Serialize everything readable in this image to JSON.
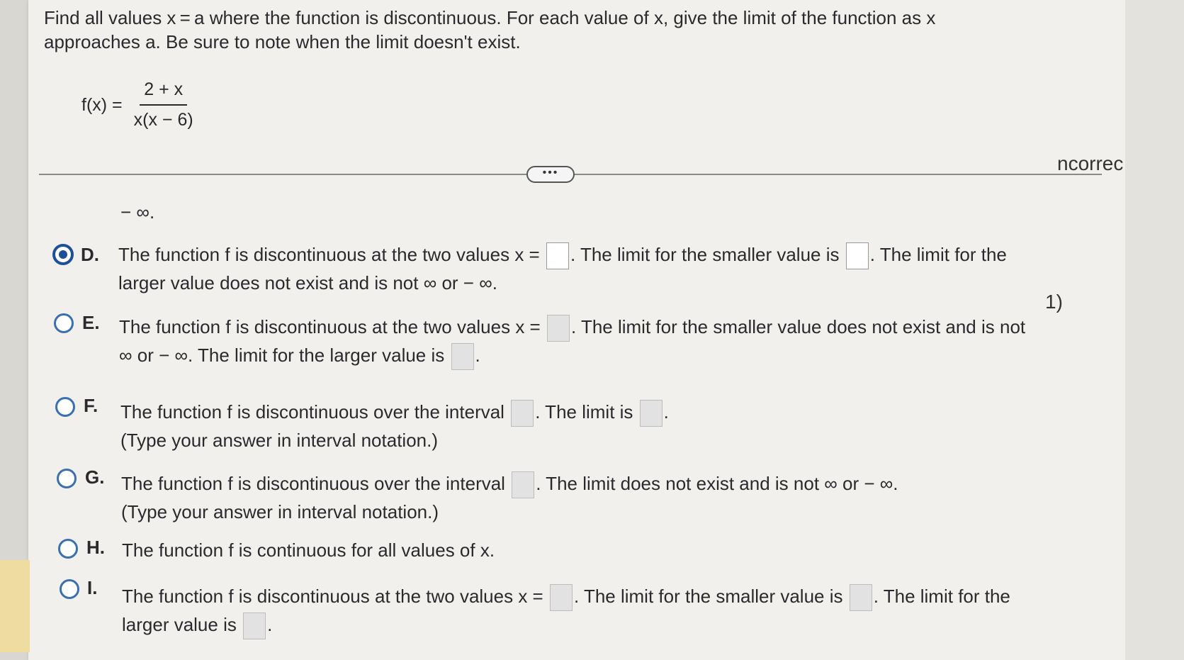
{
  "question": "Find all values x = a where the function is discontinuous. For each value of x, give the limit of the function as x approaches a. Be sure to note when the limit doesn't exist.",
  "function_label": "f(x) =",
  "numerator": "2 + x",
  "denominator": "x(x − 6)",
  "more_button": "•••",
  "fragment": "− ∞.",
  "side_panel": {
    "label": "ncorrec",
    "number": "1)"
  },
  "options": {
    "D": {
      "letter": "D.",
      "selected": true,
      "p1": "The function f is discontinuous at the two values x =",
      "p2": ". The limit for the smaller value is",
      "p3": ". The limit for the",
      "p4": "larger value does not exist and is not ∞ or − ∞."
    },
    "E": {
      "letter": "E.",
      "selected": false,
      "p1": "The function f is discontinuous at the two values x =",
      "p2": ". The limit for the smaller value does not exist and is not",
      "p3": "∞ or − ∞. The limit for the larger value is",
      "p4": "."
    },
    "F": {
      "letter": "F.",
      "selected": false,
      "p1": "The function f is discontinuous over the interval",
      "p2": ". The limit is",
      "p3": ".",
      "p4": "(Type your answer in interval notation.)"
    },
    "G": {
      "letter": "G.",
      "selected": false,
      "p1": "The function f is discontinuous over the interval",
      "p2": ". The limit does not exist and is not ∞ or − ∞.",
      "p3": "(Type your answer in interval notation.)"
    },
    "H": {
      "letter": "H.",
      "selected": false,
      "p1": "The function f is continuous for all values of x."
    },
    "I": {
      "letter": "I.",
      "selected": false,
      "p1": "The function f is discontinuous at the two values x =",
      "p2": ". The limit for the smaller value is",
      "p3": ". The limit for the",
      "p4": "larger value is",
      "p5": "."
    }
  }
}
